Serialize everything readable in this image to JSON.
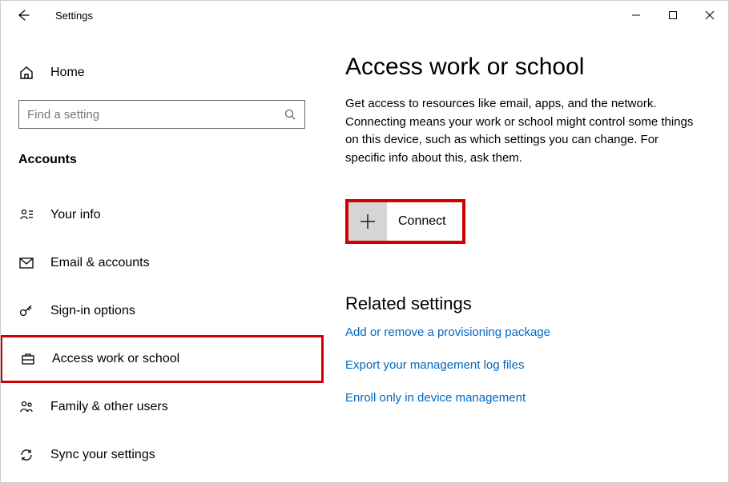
{
  "window": {
    "title": "Settings"
  },
  "sidebar": {
    "home_label": "Home",
    "search_placeholder": "Find a setting",
    "category": "Accounts",
    "items": [
      {
        "label": "Your info"
      },
      {
        "label": "Email & accounts"
      },
      {
        "label": "Sign-in options"
      },
      {
        "label": "Access work or school"
      },
      {
        "label": "Family & other users"
      },
      {
        "label": "Sync your settings"
      }
    ]
  },
  "main": {
    "heading": "Access work or school",
    "description": "Get access to resources like email, apps, and the network. Connecting means your work or school might control some things on this device, such as which settings you can change. For specific info about this, ask them.",
    "connect_label": "Connect",
    "related_heading": "Related settings",
    "links": [
      "Add or remove a provisioning package",
      "Export your management log files",
      "Enroll only in device management"
    ]
  }
}
